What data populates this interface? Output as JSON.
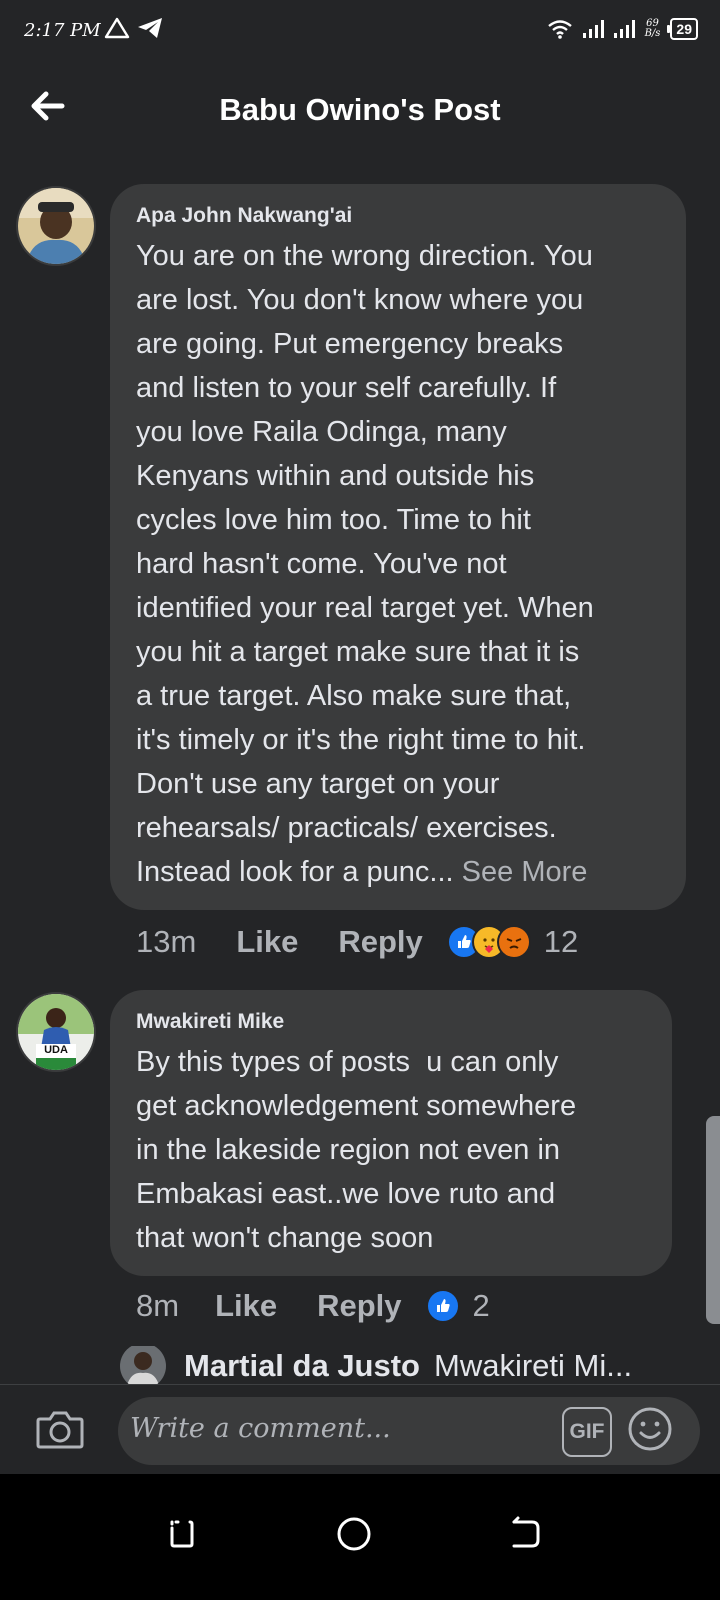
{
  "status_bar": {
    "time": "2:17 PM",
    "left_icons": [
      "alert-triangle-icon",
      "telegram-icon"
    ],
    "right_icons": [
      "wifi-icon",
      "signal-icon",
      "signal-icon"
    ],
    "speed_value": "69",
    "speed_unit": "B/s",
    "battery": "29"
  },
  "header": {
    "title": "Babu Owino's Post",
    "back_icon": "back-arrow-icon"
  },
  "comments": [
    {
      "author": "Apa John Nakwang'ai",
      "lines": [
        "You are on the wrong direction. You",
        "are lost. You don't know where you",
        "are going. Put emergency breaks",
        "and listen to your self carefully. If",
        "you love Raila Odinga, many",
        "Kenyans within and outside his",
        "cycles love him too. Time to hit",
        "hard hasn't come. You've not",
        "identified your real target yet. When",
        "you hit a target make sure that it is",
        "a true target. Also make sure that,",
        "it's timely or it's the right time to hit.",
        "Don't use any target on your",
        "rehearsals/ practicals/ exercises.",
        "Instead look for a punc..."
      ],
      "see_more": "See More",
      "time": "13m",
      "like": "Like",
      "reply": "Reply",
      "reactions": [
        "like-reaction-icon",
        "care-reaction-icon",
        "angry-reaction-icon"
      ],
      "reaction_count": "12"
    },
    {
      "author": "Mwakireti Mike",
      "avatar_badge": "UDA",
      "lines": [
        "By this types of posts  u can only",
        "get acknowledgement somewhere",
        "in the lakeside region not even in",
        "Embakasi east..we love ruto and",
        "that won't change soon"
      ],
      "time": "8m",
      "like": "Like",
      "reply": "Reply",
      "reactions": [
        "like-reaction-icon"
      ],
      "reaction_count": "2"
    }
  ],
  "reply_preview": {
    "author": "Martial da Justo",
    "text": "Mwakireti Mi..."
  },
  "composer": {
    "placeholder": "Write a comment...",
    "gif_label": "GIF"
  },
  "colors": {
    "background": "#242527",
    "bubble": "#3a3b3c",
    "text_primary": "#e4e6eb",
    "text_secondary": "#b0b3b8",
    "like_blue": "#1877f2",
    "angry_orange": "#e9710f"
  }
}
